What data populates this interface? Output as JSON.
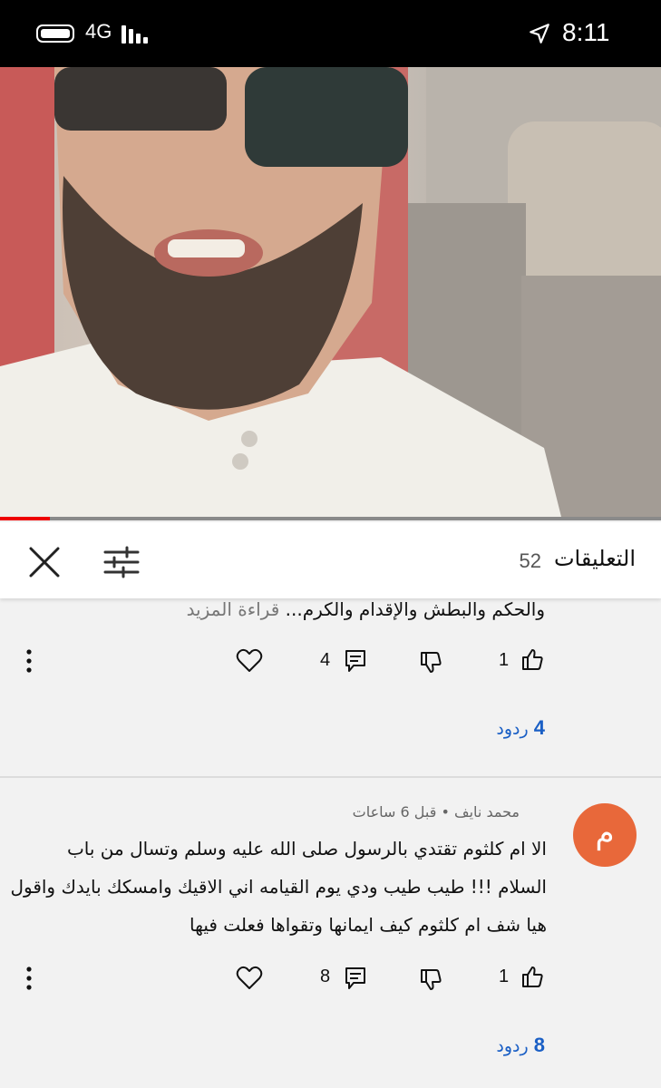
{
  "status_bar": {
    "network": "4G",
    "time": "8:11"
  },
  "video": {
    "progress_fraction": 0.075
  },
  "comments_header": {
    "title": "التعليقات",
    "count": "52"
  },
  "comment1": {
    "text_tail": "والحكم والبطش والإقدام والكرم...",
    "read_more": "قراءة المزيد",
    "likes": "1",
    "replies_count": "4",
    "replies_num": "4",
    "replies_word": "ردود"
  },
  "comment2": {
    "avatar_letter": "م",
    "author": "محمد نايف",
    "separator": "•",
    "time": "قبل 6 ساعات",
    "lines": [
      "الا ام كلثوم تقتدي بالرسول صلى الله عليه وسلم وتسال من باب",
      "السلام !!! طيب طيب ودي يوم القيامه اني الاقيك وامسكك بايدك واقول",
      "هيا شف ام كلثوم كيف ايمانها وتقواها فعلت فيها"
    ],
    "likes": "1",
    "replies_count": "8",
    "replies_num": "8",
    "replies_word": "ردود"
  }
}
